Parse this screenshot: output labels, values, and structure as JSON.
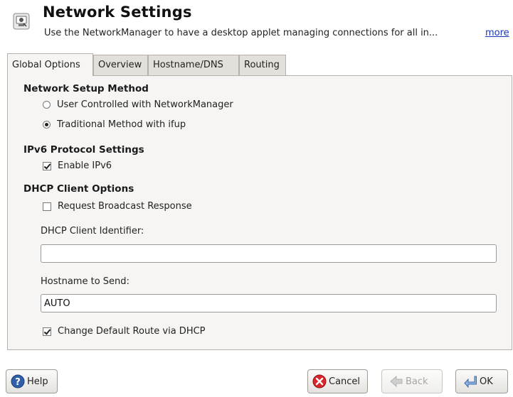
{
  "header": {
    "title": "Network Settings",
    "subtitle": "Use the NetworkManager to have a desktop applet managing connections for all in...",
    "more_link": "more"
  },
  "tabs": [
    {
      "label": "Global Options",
      "active": true
    },
    {
      "label": "Overview",
      "active": false
    },
    {
      "label": "Hostname/DNS",
      "active": false
    },
    {
      "label": "Routing",
      "active": false
    }
  ],
  "setup_method": {
    "title": "Network Setup Method",
    "options": [
      {
        "label": "User Controlled with NetworkManager",
        "selected": false
      },
      {
        "label": "Traditional Method with ifup",
        "selected": true
      }
    ]
  },
  "ipv6": {
    "title": "IPv6 Protocol Settings",
    "enable_label": "Enable IPv6",
    "enabled": true
  },
  "dhcp": {
    "title": "DHCP Client Options",
    "broadcast_label": "Request Broadcast Response",
    "broadcast_checked": false,
    "identifier_label": "DHCP Client Identifier:",
    "identifier_value": "",
    "hostname_label": "Hostname to Send:",
    "hostname_value": "AUTO",
    "default_route_label": "Change Default Route via DHCP",
    "default_route_checked": true
  },
  "buttons": {
    "help": "Help",
    "cancel": "Cancel",
    "back": "Back",
    "ok": "OK"
  },
  "colors": {
    "link": "#1a35b8",
    "panel_bg": "#f6f5f3",
    "cancel_icon": "#d8262a",
    "help_icon": "#2f5fa8"
  },
  "icons": {
    "app": "network-settings-icon",
    "help": "help-icon",
    "cancel": "cancel-icon",
    "back": "back-arrow-icon",
    "ok": "ok-return-icon"
  }
}
